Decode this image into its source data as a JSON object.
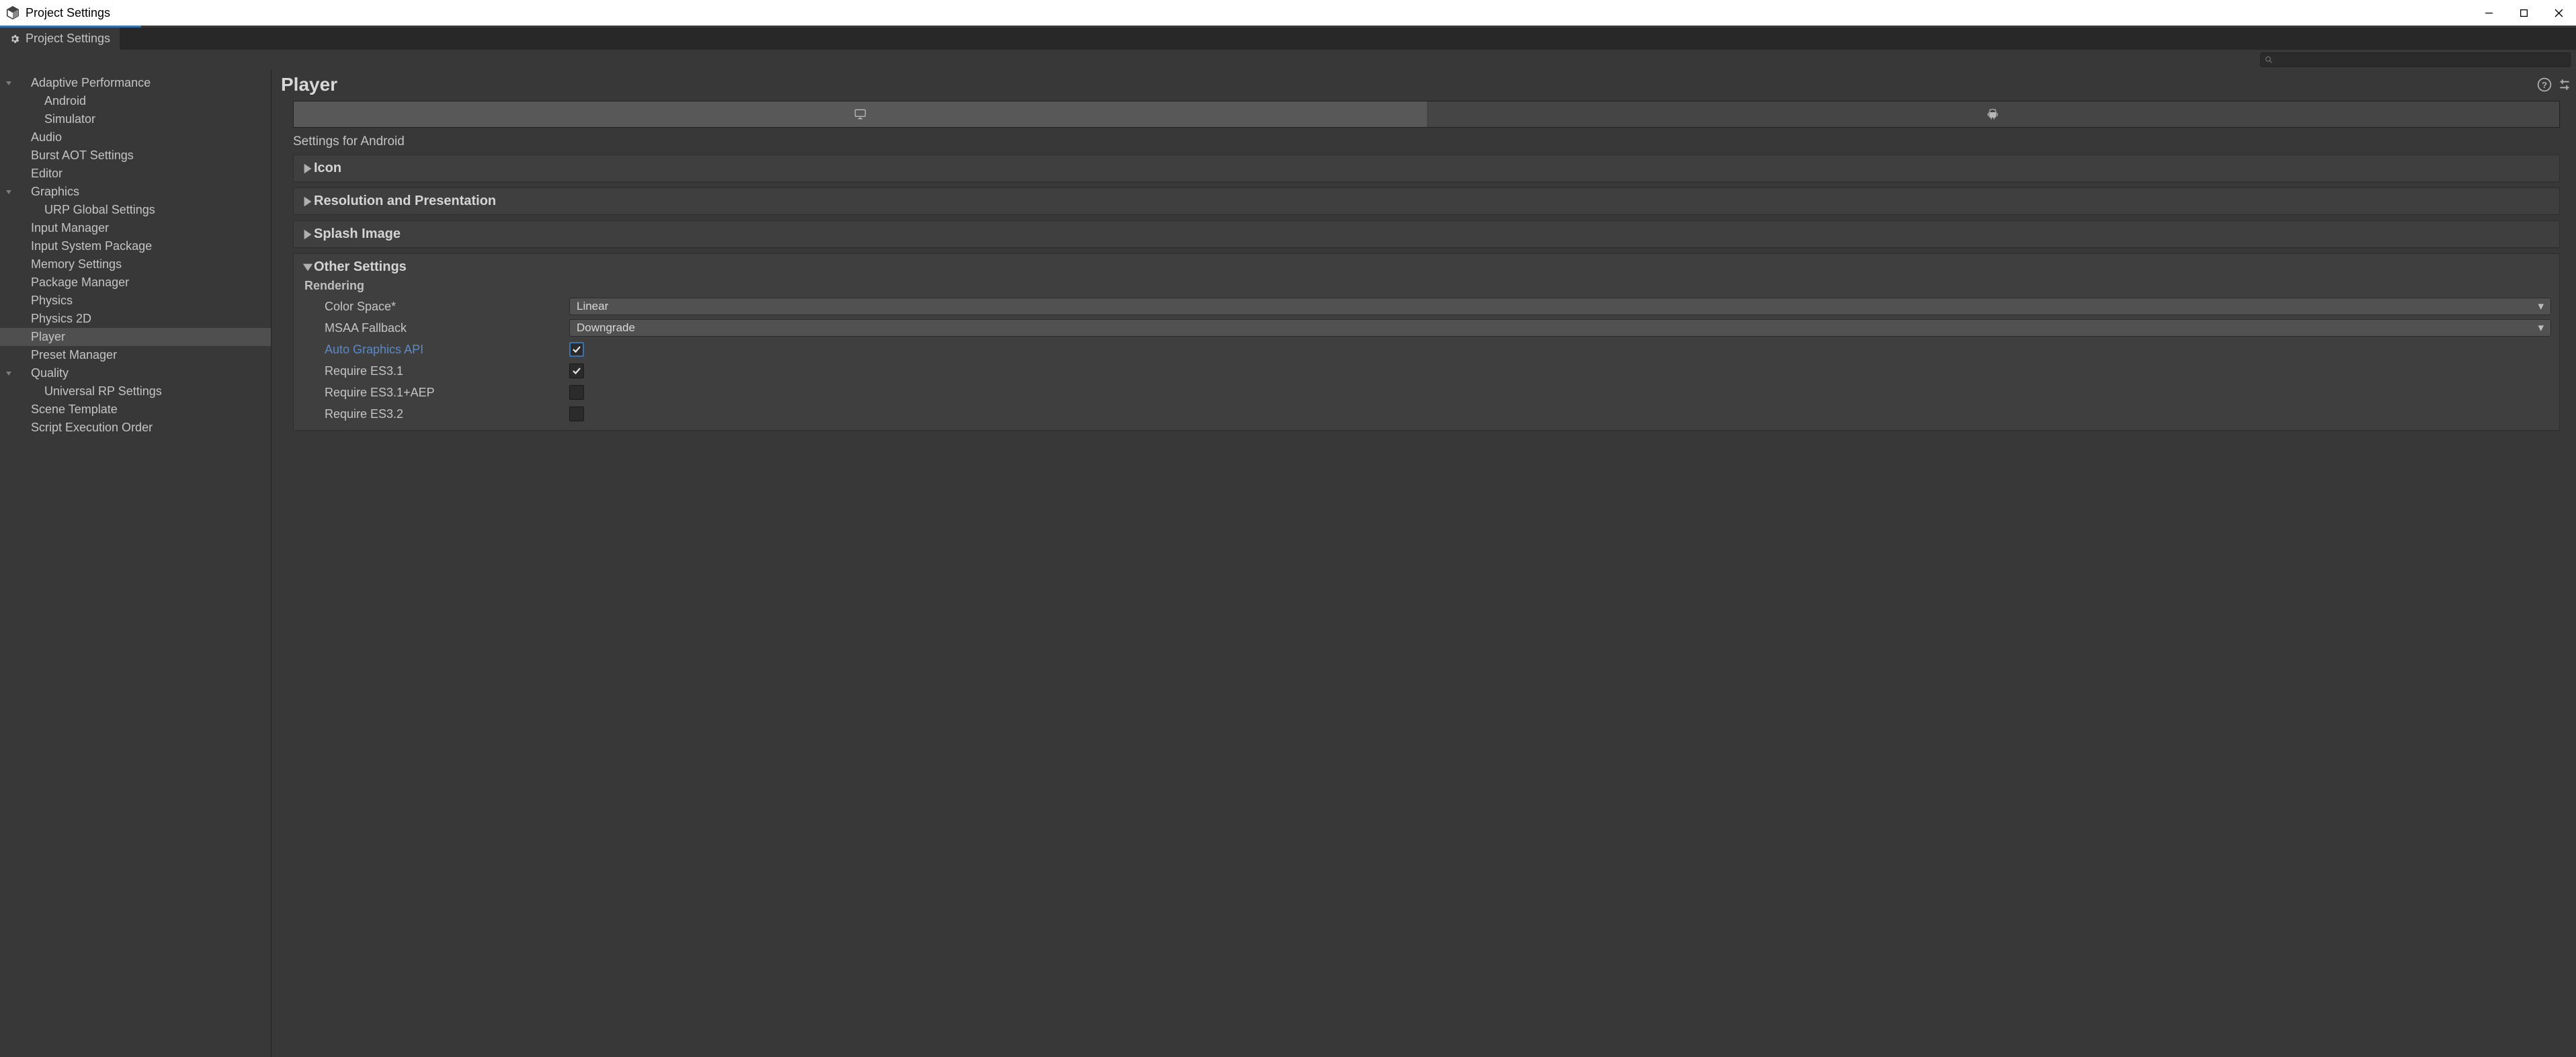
{
  "window": {
    "title": "Project Settings"
  },
  "tab": {
    "title": "Project Settings"
  },
  "sidebar": {
    "items": [
      {
        "label": "Adaptive Performance",
        "level": 1,
        "caret": "down"
      },
      {
        "label": "Android",
        "level": 2
      },
      {
        "label": "Simulator",
        "level": 2
      },
      {
        "label": "Audio",
        "level": 1
      },
      {
        "label": "Burst AOT Settings",
        "level": 1
      },
      {
        "label": "Editor",
        "level": 1
      },
      {
        "label": "Graphics",
        "level": 1,
        "caret": "down"
      },
      {
        "label": "URP Global Settings",
        "level": 2
      },
      {
        "label": "Input Manager",
        "level": 1
      },
      {
        "label": "Input System Package",
        "level": 1
      },
      {
        "label": "Memory Settings",
        "level": 1
      },
      {
        "label": "Package Manager",
        "level": 1
      },
      {
        "label": "Physics",
        "level": 1
      },
      {
        "label": "Physics 2D",
        "level": 1
      },
      {
        "label": "Player",
        "level": 1,
        "selected": true
      },
      {
        "label": "Preset Manager",
        "level": 1
      },
      {
        "label": "Quality",
        "level": 1,
        "caret": "down"
      },
      {
        "label": "Universal RP Settings",
        "level": 2
      },
      {
        "label": "Scene Template",
        "level": 1
      },
      {
        "label": "Script Execution Order",
        "level": 1
      }
    ]
  },
  "main": {
    "title": "Player",
    "subtitle": "Settings for Android",
    "sections": {
      "icon": "Icon",
      "resolution": "Resolution and Presentation",
      "splash": "Splash Image",
      "other": "Other Settings"
    },
    "rendering": {
      "title": "Rendering",
      "color_space": {
        "label": "Color Space*",
        "value": "Linear"
      },
      "msaa_fallback": {
        "label": "MSAA Fallback",
        "value": "Downgrade"
      },
      "auto_graphics_api": {
        "label": "Auto Graphics API",
        "checked": true,
        "highlighted": true
      },
      "require_es31": {
        "label": "Require ES3.1",
        "checked": true
      },
      "require_es31aep": {
        "label": "Require ES3.1+AEP",
        "checked": false
      },
      "require_es32": {
        "label": "Require ES3.2",
        "checked": false
      }
    }
  }
}
